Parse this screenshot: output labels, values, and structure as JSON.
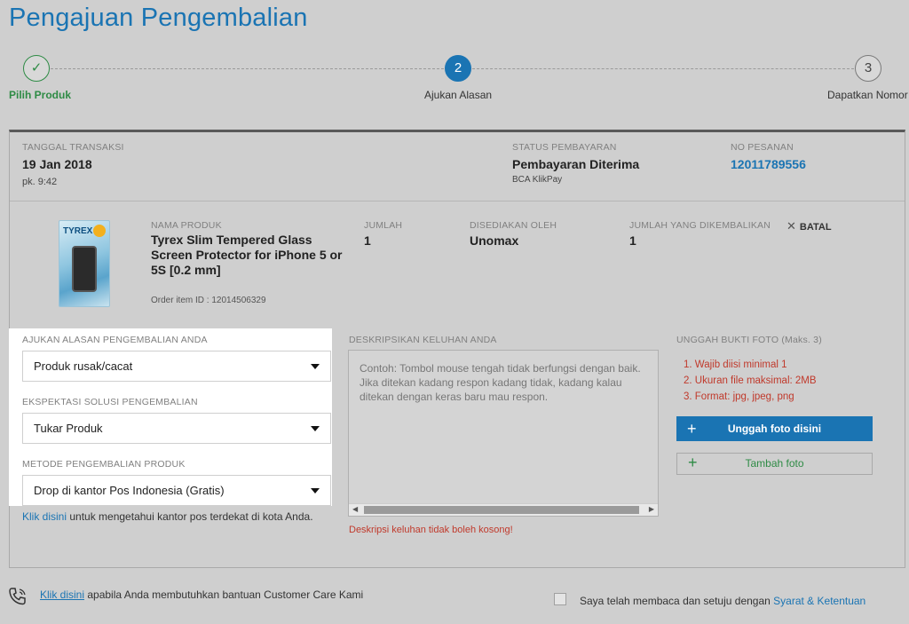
{
  "page_title": "Pengajuan Pengembalian",
  "stepper": [
    {
      "number": "✓",
      "label": "Pilih Produk",
      "state": "done"
    },
    {
      "number": "2",
      "label": "Ajukan Alasan",
      "state": "active"
    },
    {
      "number": "3",
      "label": "Dapatkan Nomor",
      "state": "todo"
    }
  ],
  "transaction": {
    "date_label": "TANGGAL TRANSAKSI",
    "date": "19 Jan 2018",
    "time": "pk. 9:42",
    "payment_status_label": "STATUS PEMBAYARAN",
    "payment_status": "Pembayaran Diterima",
    "payment_method": "BCA KlikPay",
    "order_no_label": "NO PESANAN",
    "order_no": "12011789556"
  },
  "product": {
    "image_brand": "TYREX",
    "name_label": "NAMA PRODUK",
    "name": "Tyrex Slim Tempered Glass Screen Protector for iPhone 5 or 5S [0.2 mm]",
    "order_item_id": "Order item ID : 12014506329",
    "qty_label": "JUMLAH",
    "qty": "1",
    "seller_label": "DISEDIAKAN OLEH",
    "seller": "Unomax",
    "return_qty_label": "JUMLAH YANG DIKEMBALIKAN",
    "return_qty": "1",
    "cancel_label": "BATAL"
  },
  "form": {
    "reason_label": "AJUKAN ALASAN PENGEMBALIAN ANDA",
    "reason_value": "Produk rusak/cacat",
    "solution_label": "EKSPEKTASI SOLUSI PENGEMBALIAN",
    "solution_value": "Tukar Produk",
    "method_label": "METODE PENGEMBALIAN PRODUK",
    "method_value": "Drop di kantor Pos Indonesia (Gratis)",
    "post_link": "Klik disini",
    "post_text": " untuk mengetahui kantor pos terdekat di kota Anda."
  },
  "description": {
    "label": "DESKRIPSIKAN KELUHAN ANDA",
    "placeholder": "Contoh: Tombol mouse tengah tidak berfungsi dengan baik. Jika ditekan kadang respon kadang tidak, kadang kalau ditekan dengan keras baru mau respon.",
    "error": "Deskripsi keluhan tidak boleh kosong!"
  },
  "upload": {
    "label": "UNGGAH BUKTI FOTO (Maks. 3)",
    "requirements": [
      "1. Wajib diisi minimal 1",
      "2. Ukuran file maksimal: 2MB",
      "3. Format: jpg, jpeg, png"
    ],
    "upload_button": "Unggah foto disini",
    "add_button": "Tambah foto"
  },
  "footer": {
    "care_link": "Klik disini",
    "care_text": " apabila Anda membutuhkan bantuan Customer Care Kami",
    "agree_text": "Saya telah membaca dan setuju dengan ",
    "terms_link": "Syarat & Ketentuan"
  },
  "colors": {
    "primary": "#1a74b3",
    "success": "#2e8b45",
    "error": "#c0392b",
    "overlay": "#cfcfcf"
  }
}
